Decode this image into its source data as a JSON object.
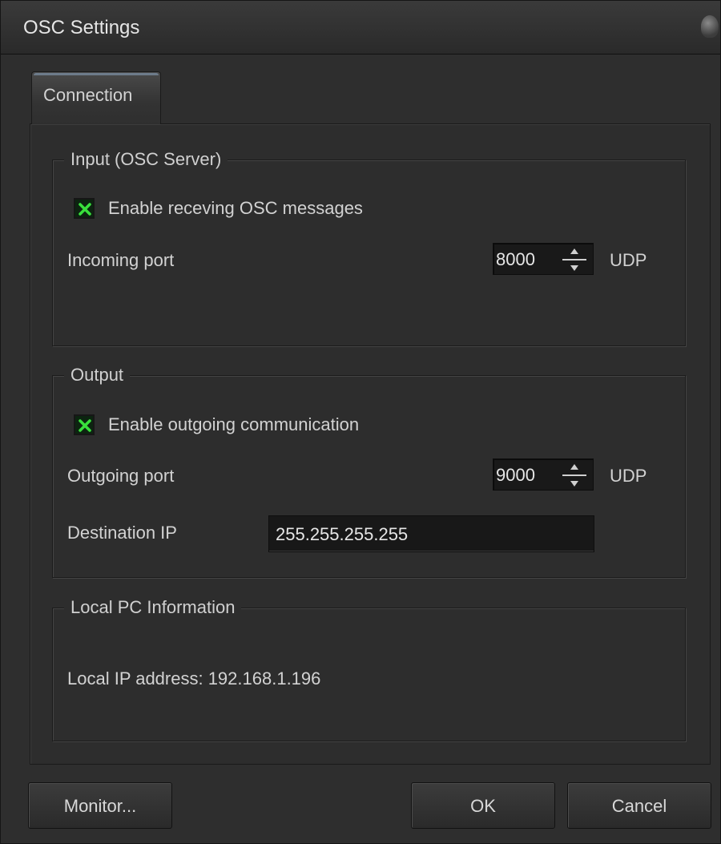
{
  "window": {
    "title": "OSC Settings"
  },
  "tabs": [
    {
      "label": "Connection",
      "active": true
    }
  ],
  "input_group": {
    "title": "Input (OSC Server)",
    "enable_label": "Enable receving OSC messages",
    "enable_checked": true,
    "port_label": "Incoming port",
    "port_value": "8000",
    "port_unit": "UDP"
  },
  "output_group": {
    "title": "Output",
    "enable_label": "Enable outgoing communication",
    "enable_checked": true,
    "port_label": "Outgoing port",
    "port_value": "9000",
    "port_unit": "UDP",
    "dest_ip_label": "Destination IP",
    "dest_ip_value": "255.255.255.255"
  },
  "local_group": {
    "title": "Local PC Information",
    "local_ip_text": "Local IP address: 192.168.1.196"
  },
  "buttons": {
    "monitor": "Monitor...",
    "ok": "OK",
    "cancel": "Cancel"
  },
  "colors": {
    "window_bg": "#2e2e2e",
    "checkbox_mark": "#39e03c",
    "field_bg": "#181818"
  }
}
